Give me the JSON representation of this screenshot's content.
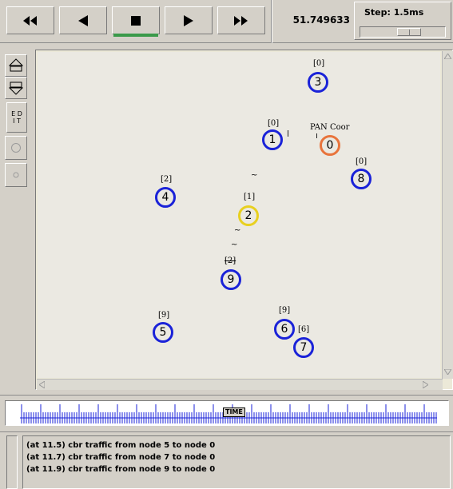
{
  "toolbar": {
    "buttons": [
      {
        "name": "rewind",
        "icon": "rewind-icon"
      },
      {
        "name": "step-back",
        "icon": "play-backward-icon"
      },
      {
        "name": "stop",
        "icon": "stop-icon"
      },
      {
        "name": "play",
        "icon": "play-forward-icon"
      },
      {
        "name": "fast-forward",
        "icon": "fast-forward-icon"
      }
    ],
    "sim_time": "51.749633",
    "step_label": "Step: 1.5ms"
  },
  "tools": {
    "edit_line1": "E D",
    "edit_line2": "I T"
  },
  "network": {
    "pan_label": "PAN Coor",
    "nodes": [
      {
        "id": "0",
        "label": "",
        "color": "#e8743c"
      },
      {
        "id": "1",
        "label": "[0]",
        "color": "#1a22d8"
      },
      {
        "id": "2",
        "label": "[1]",
        "color": "#e8d020"
      },
      {
        "id": "3",
        "label": "[0]",
        "color": "#1a22d8"
      },
      {
        "id": "4",
        "label": "[2]",
        "color": "#1a22d8"
      },
      {
        "id": "5",
        "label": "[9]",
        "color": "#1a22d8"
      },
      {
        "id": "6",
        "label": "[9]",
        "color": "#1a22d8"
      },
      {
        "id": "7",
        "label": "[6]",
        "color": "#1a22d8"
      },
      {
        "id": "8",
        "label": "[0]",
        "color": "#1a22d8"
      },
      {
        "id": "9",
        "label": "[2]",
        "color": "#1a22d8"
      }
    ]
  },
  "timeline": {
    "marker": "TIME"
  },
  "log": [
    "(at 11.5) cbr traffic from node 5 to node 0",
    "(at 11.7) cbr traffic from node 7 to node 0",
    "(at 11.9) cbr traffic from node 9 to node 0"
  ]
}
